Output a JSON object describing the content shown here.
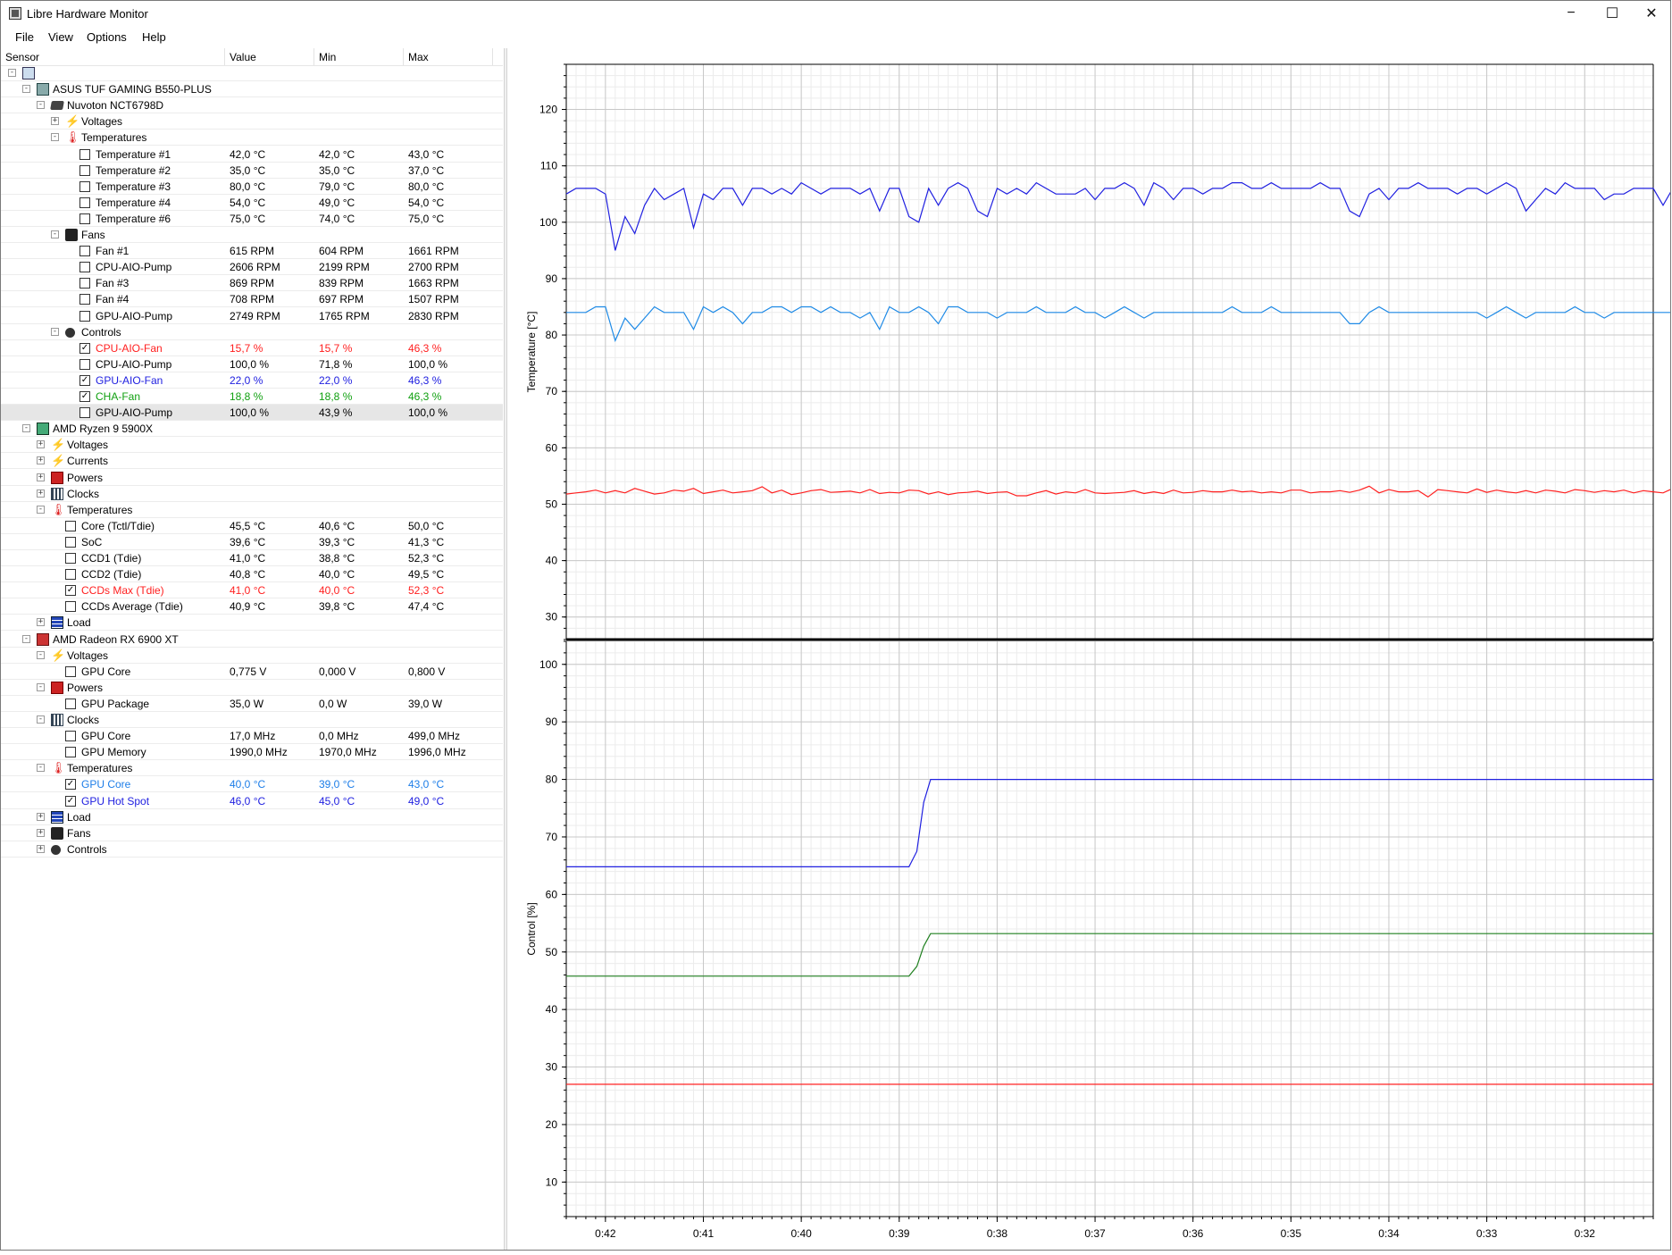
{
  "window": {
    "title": "Libre Hardware Monitor",
    "minimize_glyph": "−",
    "maximize_glyph": "☐",
    "close_glyph": "✕"
  },
  "menu": [
    "File",
    "View",
    "Options",
    "Help"
  ],
  "columns": {
    "sensor": "Sensor",
    "value": "Value",
    "min": "Min",
    "max": "Max"
  },
  "tree": [
    {
      "level": 0,
      "exp": "-",
      "icon": "computer",
      "label": ""
    },
    {
      "level": 1,
      "exp": "-",
      "icon": "board",
      "label": "ASUS TUF GAMING B550-PLUS"
    },
    {
      "level": 2,
      "exp": "-",
      "icon": "chip",
      "label": "Nuvoton NCT6798D"
    },
    {
      "level": 3,
      "exp": "+",
      "icon": "volt",
      "label": "Voltages"
    },
    {
      "level": 3,
      "exp": "-",
      "icon": "temp",
      "label": "Temperatures"
    },
    {
      "level": 4,
      "chk": false,
      "label": "Temperature #1",
      "value": "42,0 °C",
      "min": "42,0 °C",
      "max": "43,0 °C"
    },
    {
      "level": 4,
      "chk": false,
      "label": "Temperature #2",
      "value": "35,0 °C",
      "min": "35,0 °C",
      "max": "37,0 °C"
    },
    {
      "level": 4,
      "chk": false,
      "label": "Temperature #3",
      "value": "80,0 °C",
      "min": "79,0 °C",
      "max": "80,0 °C"
    },
    {
      "level": 4,
      "chk": false,
      "label": "Temperature #4",
      "value": "54,0 °C",
      "min": "49,0 °C",
      "max": "54,0 °C"
    },
    {
      "level": 4,
      "chk": false,
      "label": "Temperature #6",
      "value": "75,0 °C",
      "min": "74,0 °C",
      "max": "75,0 °C"
    },
    {
      "level": 3,
      "exp": "-",
      "icon": "fan",
      "label": "Fans"
    },
    {
      "level": 4,
      "chk": false,
      "label": "Fan #1",
      "value": "615 RPM",
      "min": "604 RPM",
      "max": "1661 RPM"
    },
    {
      "level": 4,
      "chk": false,
      "label": "CPU-AIO-Pump",
      "value": "2606 RPM",
      "min": "2199 RPM",
      "max": "2700 RPM"
    },
    {
      "level": 4,
      "chk": false,
      "label": "Fan #3",
      "value": "869 RPM",
      "min": "839 RPM",
      "max": "1663 RPM"
    },
    {
      "level": 4,
      "chk": false,
      "label": "Fan #4",
      "value": "708 RPM",
      "min": "697 RPM",
      "max": "1507 RPM"
    },
    {
      "level": 4,
      "chk": false,
      "label": "GPU-AIO-Pump",
      "value": "2749 RPM",
      "min": "1765 RPM",
      "max": "2830 RPM"
    },
    {
      "level": 3,
      "exp": "-",
      "icon": "ctrl",
      "label": "Controls"
    },
    {
      "level": 4,
      "chk": true,
      "color": "red",
      "label": "CPU-AIO-Fan",
      "value": "15,7 %",
      "min": "15,7 %",
      "max": "46,3 %"
    },
    {
      "level": 4,
      "chk": false,
      "label": "CPU-AIO-Pump",
      "value": "100,0 %",
      "min": "71,8 %",
      "max": "100,0 %"
    },
    {
      "level": 4,
      "chk": true,
      "color": "blue",
      "label": "GPU-AIO-Fan",
      "value": "22,0 %",
      "min": "22,0 %",
      "max": "46,3 %"
    },
    {
      "level": 4,
      "chk": true,
      "color": "green",
      "label": "CHA-Fan",
      "value": "18,8 %",
      "min": "18,8 %",
      "max": "46,3 %"
    },
    {
      "level": 4,
      "chk": false,
      "selected": true,
      "label": "GPU-AIO-Pump",
      "value": "100,0 %",
      "min": "43,9 %",
      "max": "100,0 %"
    },
    {
      "level": 1,
      "exp": "-",
      "icon": "cpu",
      "label": "AMD Ryzen 9 5900X"
    },
    {
      "level": 2,
      "exp": "+",
      "icon": "volt",
      "label": "Voltages"
    },
    {
      "level": 2,
      "exp": "+",
      "icon": "volt",
      "label": "Currents"
    },
    {
      "level": 2,
      "exp": "+",
      "icon": "power",
      "label": "Powers"
    },
    {
      "level": 2,
      "exp": "+",
      "icon": "clock",
      "label": "Clocks"
    },
    {
      "level": 2,
      "exp": "-",
      "icon": "temp",
      "label": "Temperatures"
    },
    {
      "level": 3,
      "chk": false,
      "label": "Core (Tctl/Tdie)",
      "value": "45,5 °C",
      "min": "40,6 °C",
      "max": "50,0 °C"
    },
    {
      "level": 3,
      "chk": false,
      "label": "SoC",
      "value": "39,6 °C",
      "min": "39,3 °C",
      "max": "41,3 °C"
    },
    {
      "level": 3,
      "chk": false,
      "label": "CCD1 (Tdie)",
      "value": "41,0 °C",
      "min": "38,8 °C",
      "max": "52,3 °C"
    },
    {
      "level": 3,
      "chk": false,
      "label": "CCD2 (Tdie)",
      "value": "40,8 °C",
      "min": "40,0 °C",
      "max": "49,5 °C"
    },
    {
      "level": 3,
      "chk": true,
      "color": "red",
      "label": "CCDs Max (Tdie)",
      "value": "41,0 °C",
      "min": "40,0 °C",
      "max": "52,3 °C"
    },
    {
      "level": 3,
      "chk": false,
      "label": "CCDs Average (Tdie)",
      "value": "40,9 °C",
      "min": "39,8 °C",
      "max": "47,4 °C"
    },
    {
      "level": 2,
      "exp": "+",
      "icon": "load",
      "label": "Load"
    },
    {
      "level": 1,
      "exp": "-",
      "icon": "gpu",
      "label": "AMD Radeon RX 6900 XT"
    },
    {
      "level": 2,
      "exp": "-",
      "icon": "volt",
      "label": "Voltages"
    },
    {
      "level": 3,
      "chk": false,
      "label": "GPU Core",
      "value": "0,775 V",
      "min": "0,000 V",
      "max": "0,800 V"
    },
    {
      "level": 2,
      "exp": "-",
      "icon": "power",
      "label": "Powers"
    },
    {
      "level": 3,
      "chk": false,
      "label": "GPU Package",
      "value": "35,0 W",
      "min": "0,0 W",
      "max": "39,0 W"
    },
    {
      "level": 2,
      "exp": "-",
      "icon": "clock",
      "label": "Clocks"
    },
    {
      "level": 3,
      "chk": false,
      "label": "GPU Core",
      "value": "17,0 MHz",
      "min": "0,0 MHz",
      "max": "499,0 MHz"
    },
    {
      "level": 3,
      "chk": false,
      "label": "GPU Memory",
      "value": "1990,0 MHz",
      "min": "1970,0 MHz",
      "max": "1996,0 MHz"
    },
    {
      "level": 2,
      "exp": "-",
      "icon": "temp",
      "label": "Temperatures"
    },
    {
      "level": 3,
      "chk": true,
      "color": "lblue",
      "label": "GPU Core",
      "value": "40,0 °C",
      "min": "39,0 °C",
      "max": "43,0 °C"
    },
    {
      "level": 3,
      "chk": true,
      "color": "blue",
      "label": "GPU Hot Spot",
      "value": "46,0 °C",
      "min": "45,0 °C",
      "max": "49,0 °C"
    },
    {
      "level": 2,
      "exp": "+",
      "icon": "load",
      "label": "Load"
    },
    {
      "level": 2,
      "exp": "+",
      "icon": "fan",
      "label": "Fans"
    },
    {
      "level": 2,
      "exp": "+",
      "icon": "ctrl",
      "label": "Controls"
    }
  ],
  "chart_data": [
    {
      "type": "line",
      "title": "",
      "ylabel": "Temperature [°C]",
      "ylim": [
        26,
        128
      ],
      "yticks": [
        30,
        40,
        50,
        60,
        70,
        80,
        90,
        100,
        110,
        120
      ],
      "xticks": [
        "0:42",
        "0:41",
        "0:40",
        "0:39",
        "0:38",
        "0:37",
        "0:36",
        "0:35",
        "0:34",
        "0:33",
        "0:32"
      ],
      "xlim": [
        0,
        11.1
      ],
      "grid": true,
      "series": [
        {
          "color": "#2020e0",
          "x_step": 0.1,
          "values": [
            105,
            106,
            106,
            106,
            105,
            95,
            101,
            98,
            103,
            106,
            104,
            105,
            106,
            99,
            105,
            104,
            106,
            106,
            103,
            106,
            106,
            105,
            106,
            105,
            107,
            106,
            105,
            106,
            106,
            106,
            105,
            106,
            102,
            106,
            106,
            101,
            100,
            106,
            103,
            106,
            107,
            106,
            102,
            101,
            106,
            105,
            106,
            105,
            107,
            106,
            105,
            105,
            105,
            106,
            104,
            106,
            106,
            107,
            106,
            103,
            107,
            106,
            104,
            106,
            106,
            105,
            106,
            106,
            107,
            107,
            106,
            106,
            107,
            106,
            106,
            106,
            106,
            107,
            106,
            106,
            102,
            101,
            105,
            106,
            104,
            106,
            106,
            107,
            106,
            106,
            106,
            105,
            106,
            106,
            105,
            106,
            107,
            106,
            102,
            104,
            106,
            105,
            107,
            106,
            106,
            106,
            104,
            105,
            105,
            106,
            106,
            106,
            103,
            106,
            106,
            106,
            104,
            105,
            106,
            106,
            107,
            108,
            106,
            106,
            106,
            106,
            105,
            106,
            99,
            107,
            106,
            106,
            103,
            106,
            99,
            106,
            105,
            106,
            106,
            104,
            106,
            106,
            106,
            105,
            106,
            104,
            106,
            105,
            105,
            105,
            105,
            99,
            105,
            106,
            106,
            104,
            105,
            105,
            106,
            105,
            106,
            105,
            106,
            105,
            105,
            105,
            105,
            105,
            104,
            105,
            105,
            106,
            105,
            105,
            105,
            105,
            105,
            96,
            103,
            105,
            104,
            101,
            98,
            105,
            105
          ]
        },
        {
          "color": "#1e8ae6",
          "x_step": 0.1,
          "values": [
            84,
            84,
            84,
            85,
            85,
            79,
            83,
            81,
            83,
            85,
            84,
            84,
            84,
            81,
            85,
            84,
            85,
            84,
            82,
            84,
            84,
            85,
            85,
            84,
            85,
            85,
            84,
            85,
            84,
            84,
            83,
            84,
            81,
            85,
            84,
            84,
            85,
            84,
            82,
            85,
            85,
            84,
            84,
            84,
            83,
            84,
            84,
            84,
            85,
            84,
            84,
            84,
            85,
            84,
            84,
            83,
            84,
            85,
            84,
            83,
            84,
            84,
            84,
            84,
            84,
            84,
            84,
            84,
            85,
            84,
            84,
            84,
            85,
            84,
            84,
            84,
            84,
            84,
            84,
            84,
            82,
            82,
            84,
            85,
            84,
            84,
            84,
            84,
            84,
            84,
            84,
            84,
            84,
            84,
            83,
            84,
            85,
            84,
            83,
            84,
            84,
            84,
            84,
            85,
            84,
            84,
            83,
            84,
            84,
            84,
            84,
            84,
            84,
            84,
            84,
            84,
            84,
            83,
            84,
            84,
            85,
            85,
            85,
            84,
            84,
            84,
            84,
            84,
            82,
            84,
            84,
            84,
            82,
            84,
            82,
            84,
            84,
            84,
            84,
            83,
            84,
            84,
            84,
            84,
            84,
            84,
            84,
            84,
            84,
            84,
            84,
            82,
            84,
            84,
            84,
            83,
            84,
            84,
            84,
            84,
            84,
            84,
            84,
            84,
            84,
            84,
            84,
            84,
            84,
            84,
            84,
            84,
            84,
            84,
            84,
            84,
            84,
            80,
            84,
            84,
            84,
            82,
            80,
            84,
            84
          ]
        },
        {
          "color": "#ff2020",
          "x_step": 0.1,
          "values": [
            51.8,
            52.0,
            52.2,
            52.5,
            52.0,
            52.4,
            52.0,
            52.8,
            52.3,
            51.8,
            52.0,
            52.5,
            52.3,
            52.8,
            51.9,
            52.2,
            52.5,
            52.0,
            52.2,
            52.4,
            53.1,
            52.0,
            52.5,
            51.7,
            52.0,
            52.4,
            52.6,
            52.1,
            52.2,
            52.3,
            52.0,
            52.6,
            51.9,
            52.1,
            52.0,
            52.5,
            52.4,
            51.8,
            52.2,
            51.7,
            52.0,
            52.1,
            52.3,
            51.9,
            52.1,
            52.2,
            51.5,
            51.5,
            52.0,
            52.4,
            51.8,
            52.2,
            52.0,
            52.6,
            52.0,
            51.9,
            52.0,
            52.1,
            52.4,
            51.9,
            52.2,
            51.9,
            52.5,
            52.0,
            52.1,
            52.4,
            52.2,
            52.2,
            52.5,
            52.2,
            52.3,
            52.0,
            52.2,
            52.0,
            52.5,
            52.5,
            52.0,
            52.2,
            52.2,
            52.4,
            52.1,
            52.5,
            53.2,
            52.0,
            52.6,
            52.2,
            52.2,
            52.4,
            51.3,
            52.6,
            52.4,
            52.2,
            52.0,
            52.7,
            52.1,
            52.5,
            52.2,
            52.0,
            52.4,
            52.0,
            52.5,
            52.3,
            52.0,
            52.6,
            52.4,
            52.1,
            52.4,
            52.2,
            52.5,
            52.0,
            52.4,
            52.2,
            52.0,
            52.8,
            52.5,
            52.0,
            52.4,
            52.0,
            52.6,
            53.0,
            52.2,
            52.5,
            52.0,
            52.5,
            51.2,
            52.8,
            52.5,
            52.2,
            52.8,
            52.6,
            53.2,
            52.8,
            52.6,
            53.5,
            52.5,
            53.8,
            52.8,
            52.5,
            53.0,
            53.2,
            52.6,
            53.0,
            52.5,
            52.8,
            53.2,
            52.4,
            53.2,
            52.8,
            52.7,
            52.6,
            52.8,
            53.2,
            52.6,
            52.4,
            52.5,
            52.8,
            52.5,
            53.4,
            52.5,
            52.8,
            53.0,
            52.6,
            52.4,
            52.8,
            53.6,
            52.4,
            52.8,
            52.5,
            52.8,
            53.0,
            52.6,
            52.4,
            52.8,
            53.0,
            52.5,
            52.8,
            52.6,
            53.0,
            52.5,
            52.6,
            53.4,
            52.2,
            53.6,
            52.4,
            52.6
          ]
        }
      ]
    },
    {
      "type": "line",
      "title": "",
      "ylabel": "Control [%]",
      "ylim": [
        4,
        104
      ],
      "yticks": [
        10,
        20,
        30,
        40,
        50,
        60,
        70,
        80,
        90,
        100
      ],
      "xticks": [
        "0:42",
        "0:41",
        "0:40",
        "0:39",
        "0:38",
        "0:37",
        "0:36",
        "0:35",
        "0:34",
        "0:33",
        "0:32"
      ],
      "xlim": [
        0,
        11.1
      ],
      "grid": true,
      "series": [
        {
          "color": "#2020e0",
          "points": [
            [
              0,
              64.8
            ],
            [
              3.5,
              64.8
            ],
            [
              3.58,
              67.5
            ],
            [
              3.65,
              76
            ],
            [
              3.72,
              80
            ],
            [
              11.1,
              80
            ]
          ]
        },
        {
          "color": "#208020",
          "points": [
            [
              0,
              45.8
            ],
            [
              3.5,
              45.8
            ],
            [
              3.58,
              47.5
            ],
            [
              3.65,
              51
            ],
            [
              3.72,
              53.2
            ],
            [
              11.1,
              53.2
            ]
          ]
        },
        {
          "color": "#ff2020",
          "points": [
            [
              0,
              27
            ],
            [
              11.1,
              27
            ]
          ]
        }
      ]
    }
  ]
}
